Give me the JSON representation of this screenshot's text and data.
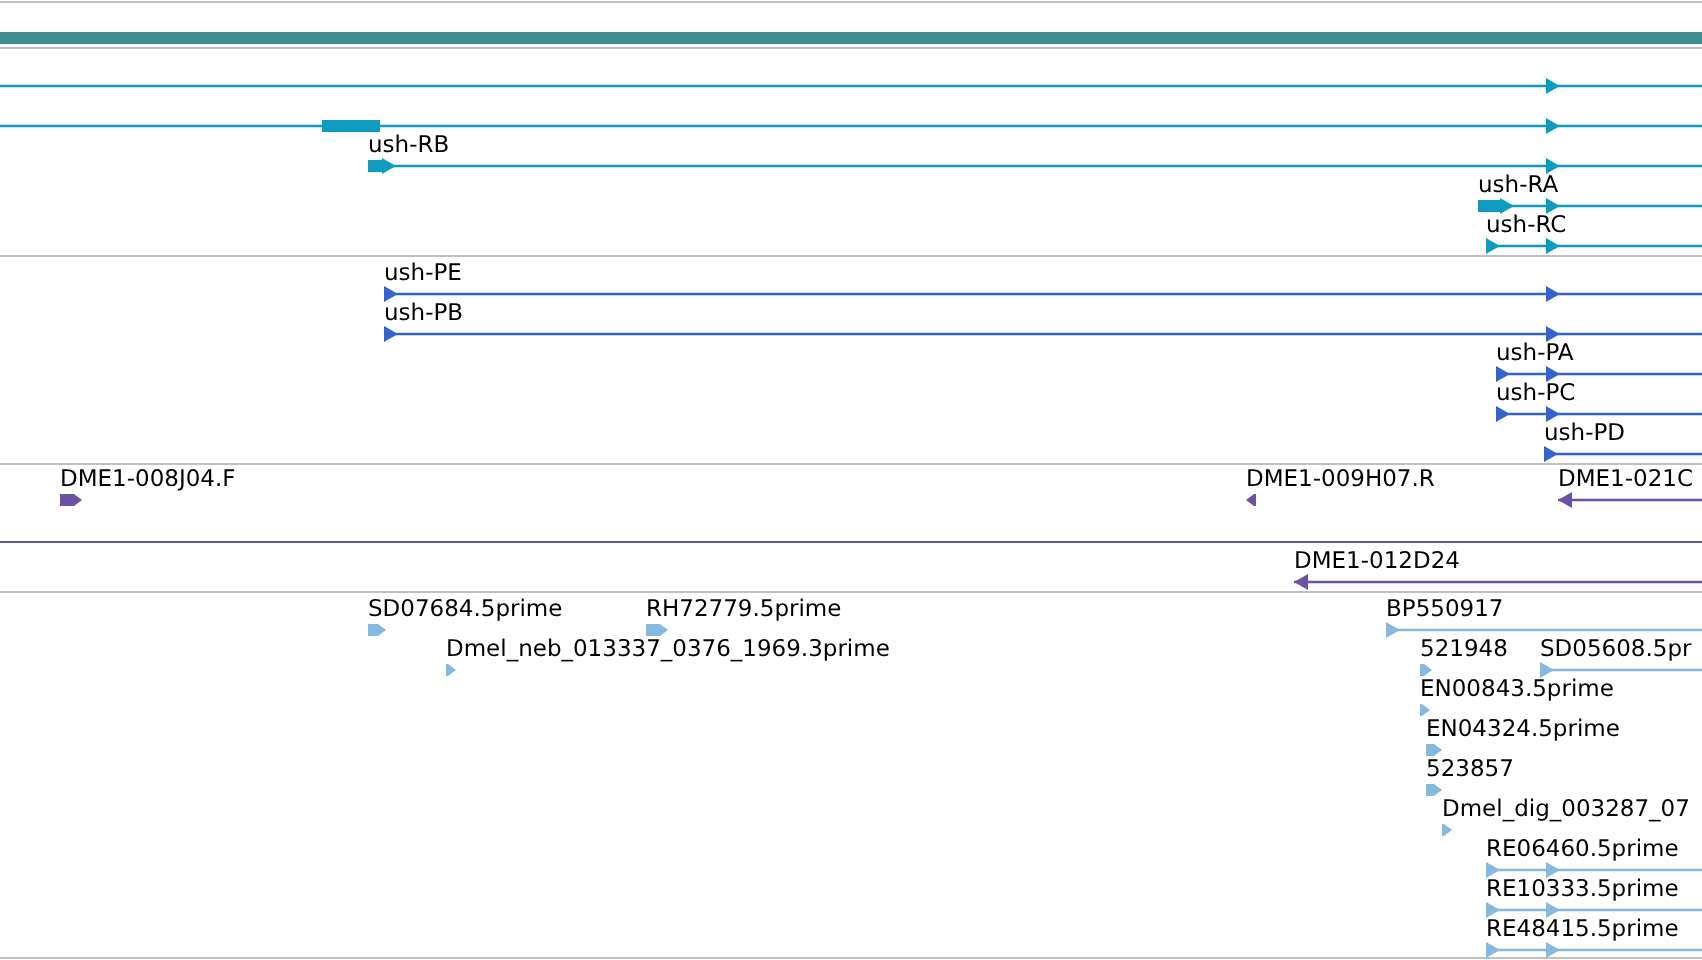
{
  "tracks": [
    {
      "kind": "transcript",
      "features": [
        {
          "reverse": false
        },
        {
          "reverse": false
        },
        {
          "label": "ush-RB",
          "reverse": false
        },
        {
          "label": "ush-RA",
          "reverse": false
        },
        {
          "label": "ush-RC",
          "reverse": false
        }
      ]
    },
    {
      "kind": "protein",
      "features": [
        {
          "label": "ush-PE",
          "reverse": false
        },
        {
          "label": "ush-PB",
          "reverse": false
        },
        {
          "label": "ush-PA",
          "reverse": false
        },
        {
          "label": "ush-PC",
          "reverse": false
        },
        {
          "label": "ush-PD",
          "reverse": false
        }
      ]
    },
    {
      "kind": "clone_end",
      "features": [
        {
          "label": "DME1-008J04.F",
          "reverse": false
        },
        {
          "label": "DME1-009H07.R",
          "reverse": true
        },
        {
          "label": "DME1-021C",
          "reverse": true
        }
      ]
    },
    {
      "kind": "clone",
      "features": [
        {
          "label": "DME1-012D24",
          "reverse": true
        }
      ]
    },
    {
      "kind": "est",
      "features": [
        {
          "label": "SD07684.5prime",
          "reverse": false
        },
        {
          "label": "RH72779.5prime",
          "reverse": false
        },
        {
          "label": "Dmel_neb_013337_0376_1969.3prime",
          "reverse": false
        },
        {
          "label": "BP550917",
          "reverse": false
        },
        {
          "label": "521948",
          "reverse": false
        },
        {
          "label": "SD05608.5pr",
          "reverse": false
        },
        {
          "label": "EN00843.5prime",
          "reverse": false
        },
        {
          "label": "EN04324.5prime",
          "reverse": false
        },
        {
          "label": "523857",
          "reverse": false
        },
        {
          "label": "Dmel_dig_003287_07",
          "reverse": false
        },
        {
          "label": "RE06460.5prime",
          "reverse": false
        },
        {
          "label": "RE10333.5prime",
          "reverse": false
        },
        {
          "label": "RE48415.5prime",
          "reverse": false
        }
      ]
    }
  ]
}
